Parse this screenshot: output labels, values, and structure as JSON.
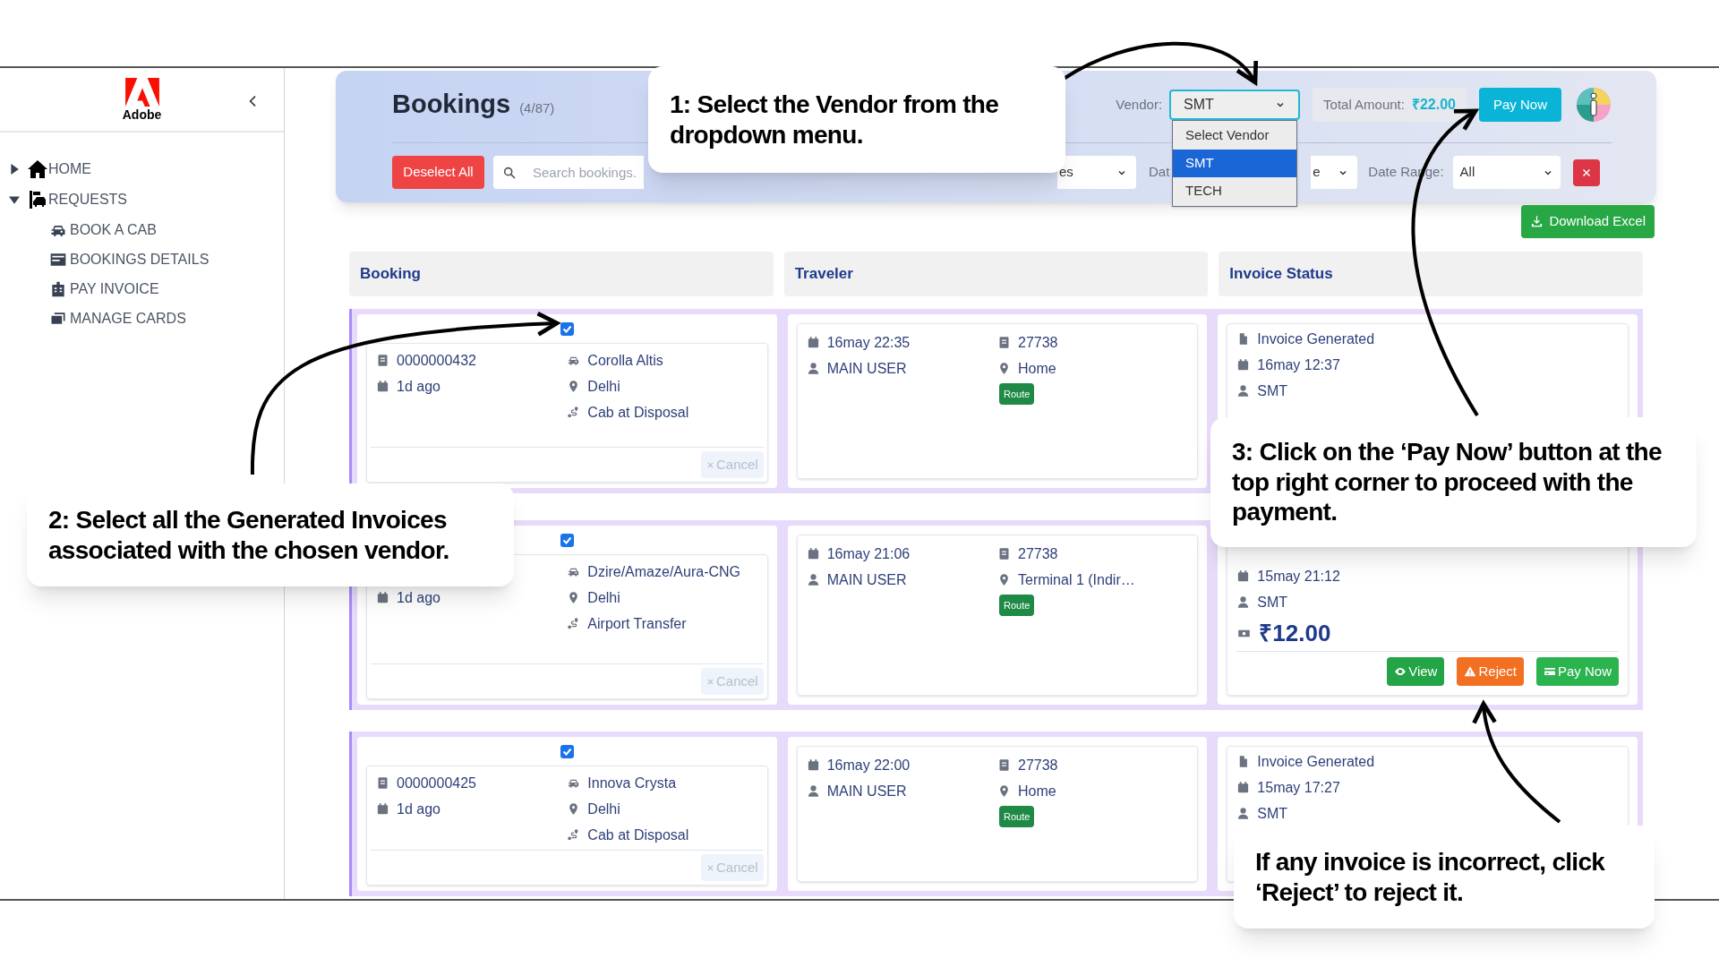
{
  "sidebar": {
    "logo": "Adobe",
    "items": [
      {
        "label": "HOME",
        "expanded": false
      },
      {
        "label": "REQUESTS",
        "expanded": true,
        "children": [
          {
            "label": "BOOK A CAB"
          },
          {
            "label": "BOOKINGS DETAILS"
          },
          {
            "label": "PAY INVOICE"
          },
          {
            "label": "MANAGE CARDS"
          }
        ]
      }
    ]
  },
  "header": {
    "title": "Bookings",
    "count": "(4/87)",
    "vendor": {
      "label": "Vendor:",
      "value": "SMT",
      "options": [
        {
          "label": "Select Vendor",
          "selected": false
        },
        {
          "label": "SMT",
          "selected": true
        },
        {
          "label": "TECH",
          "selected": false
        }
      ]
    },
    "total": {
      "label": "Total Amount:",
      "value": "₹22.00"
    },
    "pay_button": "Pay Now"
  },
  "filters": {
    "deselect_button": "Deselect All",
    "search": {
      "placeholder": "Search bookings."
    },
    "filter_1_value": "es",
    "filter_2_label": "Dat",
    "filter_2_value": "e",
    "date_range": {
      "label": "Date Range:",
      "value": "All"
    }
  },
  "download_button": "Download Excel",
  "table": {
    "columns": [
      "Booking",
      "Traveler",
      "Invoice Status"
    ],
    "rows": [
      {
        "checked": true,
        "booking": {
          "id": "0000000432",
          "age": "1d ago",
          "car": "Corolla Altis",
          "city": "Delhi",
          "trip": "Cab at Disposal",
          "cancel": "Cancel"
        },
        "traveler": {
          "time": "16may 22:35",
          "user": "MAIN USER",
          "code": "27738",
          "place": "Home",
          "route": "Route"
        },
        "invoice": {
          "status": "Invoice Generated",
          "time": "16may 12:37",
          "vendor": "SMT"
        }
      },
      {
        "checked": true,
        "booking": {
          "age": "1d ago",
          "car": "Dzire/Amaze/Aura-CNG",
          "city": "Delhi",
          "trip": "Airport Transfer",
          "cancel": "Cancel"
        },
        "traveler": {
          "time": "16may 21:06",
          "user": "MAIN USER",
          "code": "27738",
          "place": "Terminal 1 (Indir…",
          "route": "Route"
        },
        "invoice": {
          "time": "15may 21:12",
          "vendor": "SMT",
          "amount": "₹12.00",
          "actions": [
            {
              "kind": "view",
              "label": "View"
            },
            {
              "kind": "reject",
              "label": "Reject"
            },
            {
              "kind": "pay",
              "label": "Pay Now"
            }
          ]
        }
      },
      {
        "checked": true,
        "booking": {
          "id": "0000000425",
          "age": "1d ago",
          "car": "Innova Crysta",
          "city": "Delhi",
          "trip": "Cab at Disposal",
          "cancel": "Cancel"
        },
        "traveler": {
          "time": "16may 22:00",
          "user": "MAIN USER",
          "code": "27738",
          "place": "Home",
          "route": "Route"
        },
        "invoice": {
          "status": "Invoice Generated",
          "time": "15may 17:27",
          "vendor": "SMT"
        }
      }
    ]
  },
  "callouts": [
    "1: Select the Vendor from the dropdown menu.",
    "2: Select all the Generated Invoices associated with the chosen vendor.",
    "3: Click on the ‘Pay Now’ button at the top right corner to proceed with the payment.",
    "If any invoice is incorrect, click ‘Reject’ to reject it."
  ]
}
